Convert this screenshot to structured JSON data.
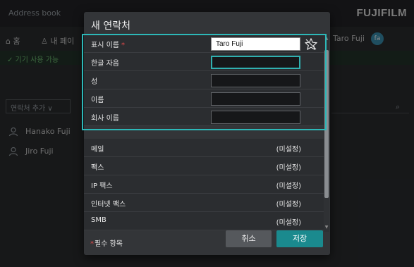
{
  "background": {
    "title": "Address book",
    "brand": "FUJIFILM",
    "toolbar": {
      "home_label": "홈",
      "addressbook_label": "내 페이",
      "user_name": "Taro Fuji",
      "user_initials": "fa"
    },
    "banner_text": "✓ 기기 사용 가능",
    "filter_label": "연락처 추가 ∨",
    "contacts": [
      "Hanako Fuji",
      "Jiro Fuji"
    ]
  },
  "dialog": {
    "title": "새 연락처",
    "fields": [
      {
        "label": "표시 이름",
        "required": true,
        "value": "Taro Fuji"
      },
      {
        "label": "한글 자음",
        "required": false,
        "value": ""
      },
      {
        "label": "성",
        "required": false,
        "value": ""
      },
      {
        "label": "이름",
        "required": false,
        "value": ""
      },
      {
        "label": "회사 이름",
        "required": false,
        "value": ""
      }
    ],
    "items": [
      {
        "label": "메일",
        "value": "(미설정)"
      },
      {
        "label": "팩스",
        "value": "(미설정)"
      },
      {
        "label": "IP 팩스",
        "value": "(미설정)"
      },
      {
        "label": "인터넷 팩스",
        "value": "(미설정)"
      },
      {
        "label": "SMB",
        "value": "(미설정)"
      }
    ],
    "required_marker": "*",
    "required_note": "필수 항목",
    "cancel_label": "취소",
    "save_label": "저장"
  },
  "colors": {
    "accent": "#1a8a8e",
    "highlight": "#2db8b8",
    "required": "#e04a4a"
  }
}
